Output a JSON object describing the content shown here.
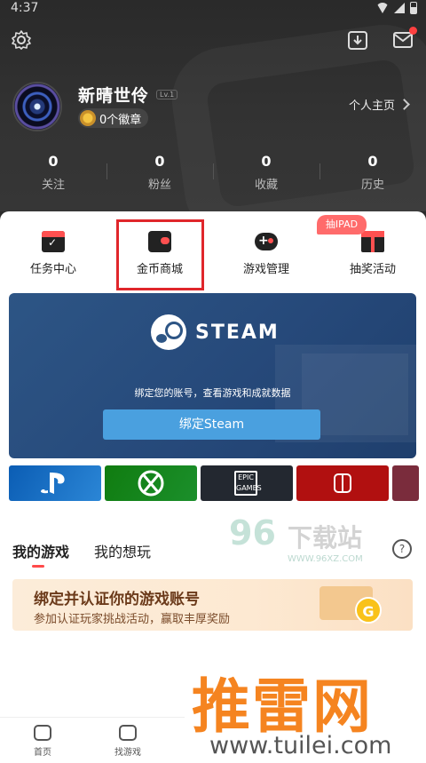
{
  "status": {
    "time": "4:37"
  },
  "profile": {
    "name": "新晴世伶",
    "level": "Lv.1",
    "badges": "0个徽章",
    "homepage": "个人主页"
  },
  "stats": [
    {
      "value": "0",
      "label": "关注"
    },
    {
      "value": "0",
      "label": "粉丝"
    },
    {
      "value": "0",
      "label": "收藏"
    },
    {
      "value": "0",
      "label": "历史"
    }
  ],
  "quick": [
    {
      "label": "任务中心",
      "icon": "calendar-icon"
    },
    {
      "label": "金币商城",
      "icon": "wallet-icon"
    },
    {
      "label": "游戏管理",
      "icon": "gamepad-icon"
    },
    {
      "label": "抽奖活动",
      "icon": "gift-icon"
    }
  ],
  "quick_tag": "抽IPAD",
  "steam": {
    "logo_text": "STEAM",
    "desc": "绑定您的账号，查看游戏和成就数据",
    "button": "绑定Steam"
  },
  "platforms": [
    {
      "name": "playstation",
      "color": "#0b5db4"
    },
    {
      "name": "xbox",
      "color": "#107c10"
    },
    {
      "name": "epic",
      "text": "EPIC GAMES",
      "color": "#232830"
    },
    {
      "name": "nintendo-switch",
      "color": "#b11010"
    }
  ],
  "tabs": {
    "mine": "我的游戏",
    "want": "我的想玩"
  },
  "bind_banner": {
    "title": "绑定并认证你的游戏账号",
    "subtitle": "参加认证玩家挑战活动，赢取丰厚奖励"
  },
  "watermark96": {
    "num": "96",
    "cn": "下载站",
    "url": "WWW.96XZ.COM"
  },
  "watermark_tuilei": {
    "cn": "推雷网",
    "url": "www.tuilei.com"
  },
  "nav": {
    "home": "首页",
    "find": "找游戏"
  }
}
